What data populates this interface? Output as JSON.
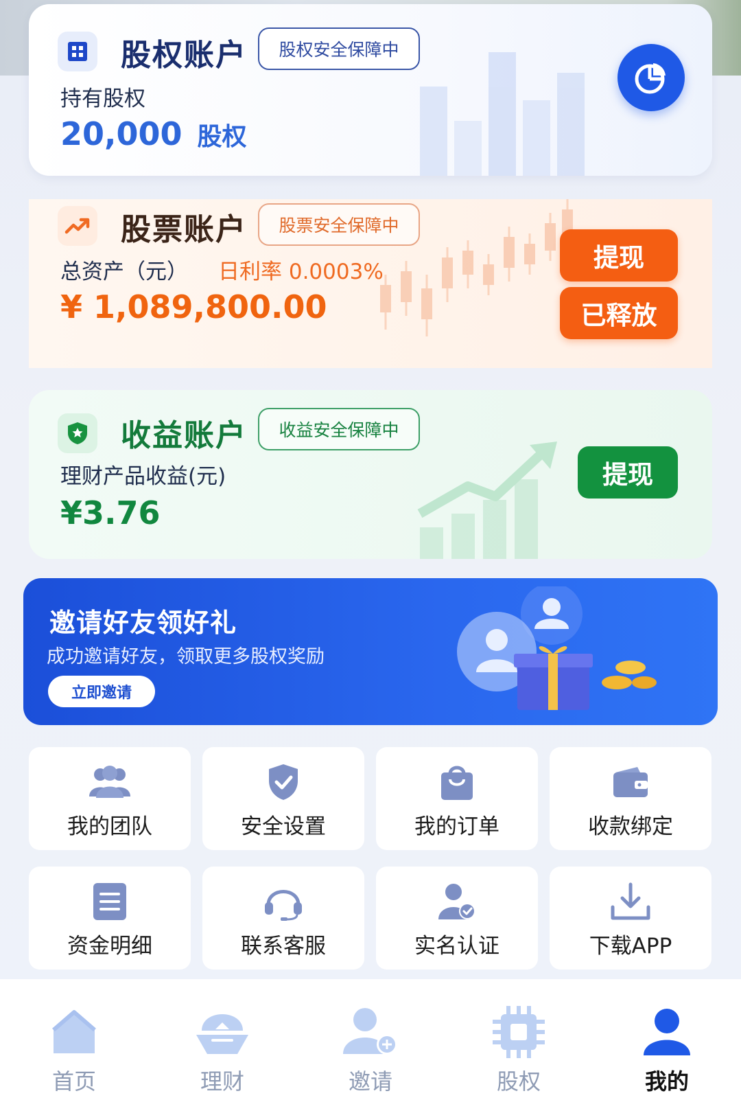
{
  "equity_account": {
    "title": "股权账户",
    "badge": "股权安全保障中",
    "label": "持有股权",
    "amount": "20,000",
    "unit": "股权",
    "icon": "building-icon",
    "action_icon": "pie-chart-icon"
  },
  "stock_account": {
    "title": "股票账户",
    "badge": "股票安全保障中",
    "label": "总资产（元）",
    "rate": "日利率 0.0003%",
    "amount": "¥ 1,089,800.00",
    "withdraw_label": "提现",
    "released_label": "已释放",
    "icon": "trend-up-icon"
  },
  "income_account": {
    "title": "收益账户",
    "badge": "收益安全保障中",
    "label": "理财产品收益(元)",
    "amount": "¥3.76",
    "withdraw_label": "提现",
    "icon": "shield-star-icon"
  },
  "invite_banner": {
    "title": "邀请好友领好礼",
    "subtitle": "成功邀请好友，领取更多股权奖励",
    "button": "立即邀请"
  },
  "menu": [
    {
      "label": "我的团队",
      "icon": "team-icon"
    },
    {
      "label": "安全设置",
      "icon": "shield-check-icon"
    },
    {
      "label": "我的订单",
      "icon": "shopping-bag-icon"
    },
    {
      "label": "收款绑定",
      "icon": "wallet-icon"
    },
    {
      "label": "资金明细",
      "icon": "document-list-icon"
    },
    {
      "label": "联系客服",
      "icon": "headset-icon"
    },
    {
      "label": "实名认证",
      "icon": "user-verified-icon"
    },
    {
      "label": "下载APP",
      "icon": "download-icon"
    }
  ],
  "tabbar": [
    {
      "label": "首页",
      "icon": "home-icon",
      "active": false
    },
    {
      "label": "理财",
      "icon": "finance-icon",
      "active": false
    },
    {
      "label": "邀请",
      "icon": "add-user-icon",
      "active": false
    },
    {
      "label": "股权",
      "icon": "chip-icon",
      "active": false
    },
    {
      "label": "我的",
      "icon": "profile-icon",
      "active": true
    }
  ],
  "colors": {
    "primary_blue": "#1f59e6",
    "orange": "#f45e12",
    "green": "#13923f",
    "icon_slate": "#7d8fc4",
    "tab_inactive": "#bcd0f3"
  }
}
